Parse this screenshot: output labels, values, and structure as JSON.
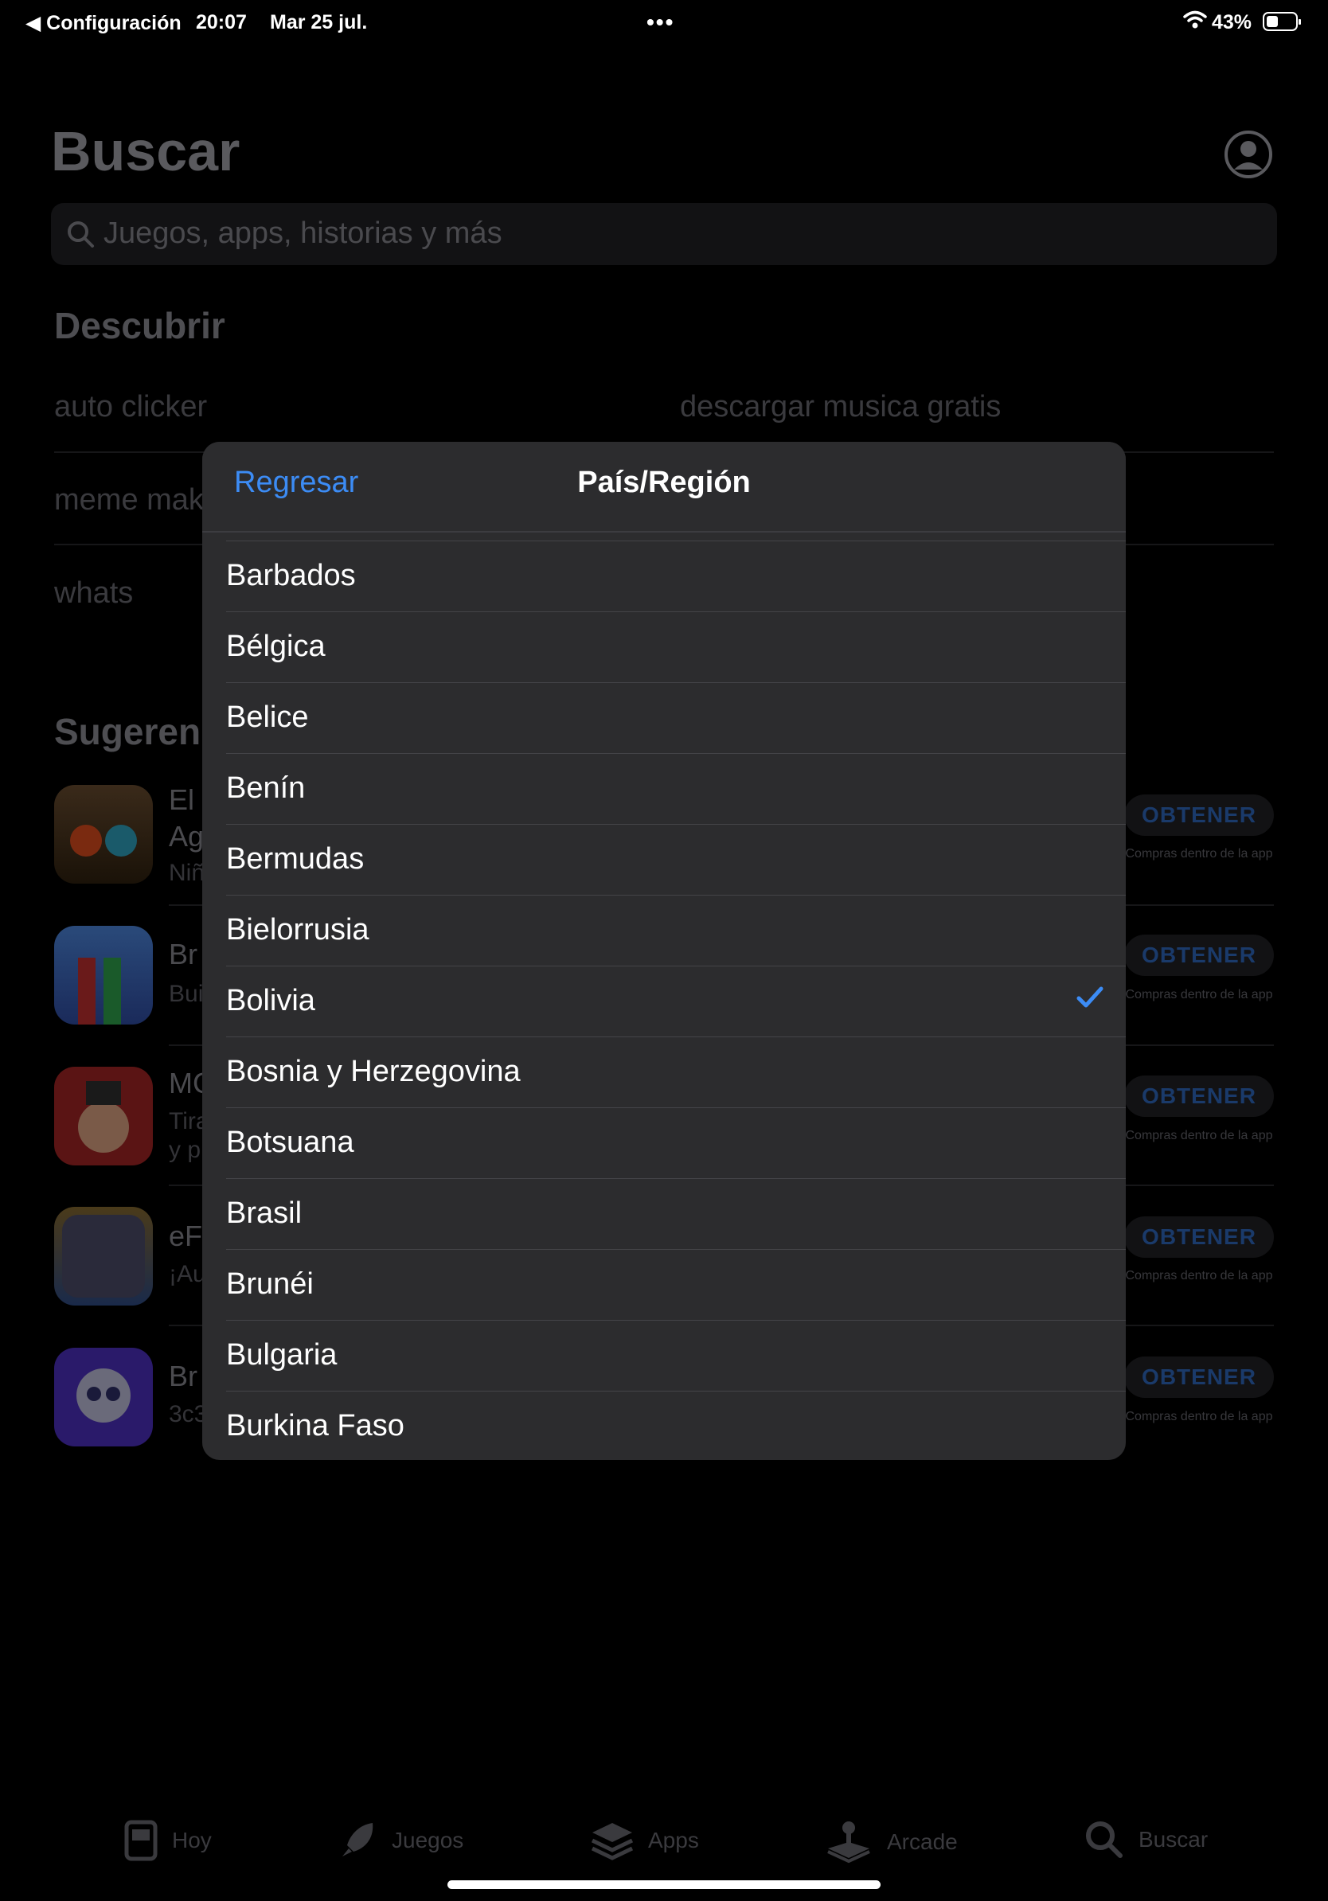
{
  "status_bar": {
    "back_label": "Configuración",
    "time": "20:07",
    "date": "Mar 25 jul.",
    "battery": "43%"
  },
  "page": {
    "title": "Buscar",
    "search_placeholder": "Juegos, apps, historias y más",
    "discover_title": "Descubrir",
    "discover_items": [
      "auto clicker",
      "descargar musica gratis",
      "meme mak",
      "whats"
    ],
    "suggestions_title": "Sugeren",
    "apps": [
      {
        "line1": "El",
        "line2": "Ag",
        "line3": "Niñ",
        "button": "OBTENER",
        "iap": "Compras dentro de la app"
      },
      {
        "line1": "Br",
        "line2": "Bui",
        "line3": "",
        "button": "OBTENER",
        "iap": "Compras dentro de la app"
      },
      {
        "line1": "MC",
        "line2": "Tira",
        "line3": "y p",
        "button": "OBTENER",
        "iap": "Compras dentro de la app"
      },
      {
        "line1": "eF",
        "line2": "¡Au",
        "line3": "",
        "button": "OBTENER",
        "iap": "Compras dentro de la app"
      },
      {
        "line1": "Br",
        "line2": "3c3",
        "line3": "",
        "button": "OBTENER",
        "iap": "Compras dentro de la app"
      }
    ]
  },
  "tab_bar": {
    "tabs": [
      {
        "label": "Hoy",
        "icon": "today-icon"
      },
      {
        "label": "Juegos",
        "icon": "rocket-icon"
      },
      {
        "label": "Apps",
        "icon": "apps-stack-icon"
      },
      {
        "label": "Arcade",
        "icon": "joystick-icon"
      },
      {
        "label": "Buscar",
        "icon": "search-icon"
      }
    ]
  },
  "modal": {
    "back_label": "Regresar",
    "title": "País/Región",
    "selected": "Bolivia",
    "countries": [
      "Barbados",
      "Bélgica",
      "Belice",
      "Benín",
      "Bermudas",
      "Bielorrusia",
      "Bolivia",
      "Bosnia y Herzegovina",
      "Botsuana",
      "Brasil",
      "Brunéi",
      "Bulgaria",
      "Burkina Faso"
    ]
  },
  "colors": {
    "accent": "#3c8cf5",
    "modal_bg": "#2c2c2e",
    "page_bg": "#000000"
  }
}
